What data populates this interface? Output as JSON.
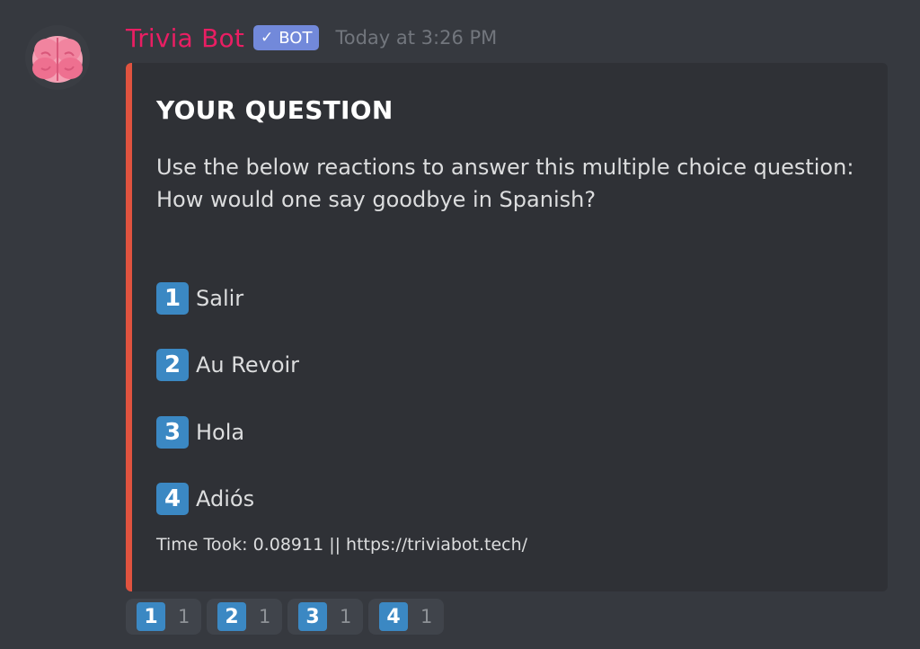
{
  "author": {
    "name": "Trivia Bot",
    "avatar_icon": "brain-icon",
    "bot_tag": "BOT",
    "timestamp": "Today at 3:26 PM",
    "name_color": "#e91e63"
  },
  "embed": {
    "accent_color": "#e0533f",
    "title": "YOUR QUESTION",
    "description_line1": "Use the below reactions to answer this multiple choice question:",
    "description_line2": "How would one say goodbye in Spanish?",
    "options": [
      {
        "key": "1",
        "label": "Salir"
      },
      {
        "key": "2",
        "label": "Au Revoir"
      },
      {
        "key": "3",
        "label": "Hola"
      },
      {
        "key": "4",
        "label": "Adiós"
      }
    ],
    "footer": "Time Took: 0.08911 || https://triviabot.tech/"
  },
  "reactions": [
    {
      "emoji": "1",
      "count": "1"
    },
    {
      "emoji": "2",
      "count": "1"
    },
    {
      "emoji": "3",
      "count": "1"
    },
    {
      "emoji": "4",
      "count": "1"
    }
  ]
}
